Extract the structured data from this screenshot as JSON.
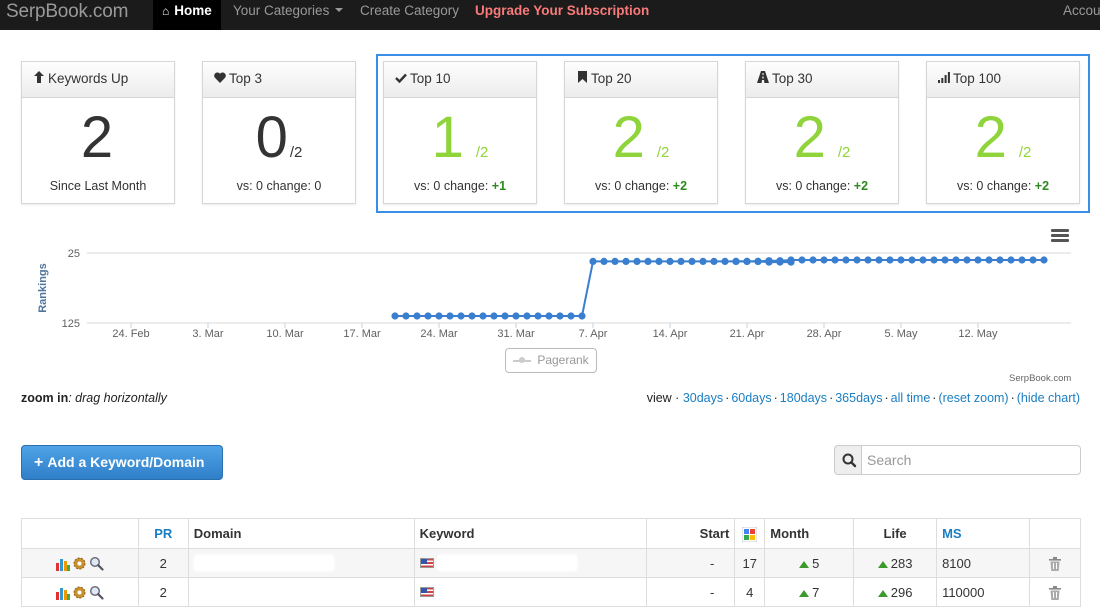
{
  "navbar": {
    "brand": "SerpBook.com",
    "home": "Home",
    "categories": "Your Categories",
    "create": "Create Category",
    "upgrade": "Upgrade Your Subscription",
    "account": "Accou"
  },
  "stats": [
    {
      "title": "Keywords Up",
      "icon": "arrow-up-icon",
      "value": "2",
      "denom": "",
      "footer_text": "Since Last Month",
      "change": ""
    },
    {
      "title": "Top 3",
      "icon": "heart-icon",
      "value": "0",
      "denom": "/2",
      "footer_text": "vs: 0 change: 0",
      "change": ""
    },
    {
      "title": "Top 10",
      "icon": "check-icon",
      "value": "1",
      "denom": "/2",
      "footer_text": "vs: 0 change: ",
      "change": "+1"
    },
    {
      "title": "Top 20",
      "icon": "bookmark-icon",
      "value": "2",
      "denom": "/2",
      "footer_text": "vs: 0 change: ",
      "change": "+2"
    },
    {
      "title": "Top 30",
      "icon": "road-icon",
      "value": "2",
      "denom": "/2",
      "footer_text": "vs: 0 change: ",
      "change": "+2"
    },
    {
      "title": "Top 100",
      "icon": "signal-icon",
      "value": "2",
      "denom": "/2",
      "footer_text": "vs: 0 change: ",
      "change": "+2"
    }
  ],
  "colors": {
    "accent_green": "#8fd43a",
    "link_blue": "#1a7ec2",
    "series_blue": "#3a7fcf",
    "highlight": "#3a8ee6"
  },
  "chart_data": {
    "type": "line",
    "ylabel": "Rankings",
    "yticks": [
      "25",
      "125"
    ],
    "ylim": [
      125,
      25
    ],
    "reversed_y": true,
    "xticks": [
      "24. Feb",
      "3. Mar",
      "10. Mar",
      "17. Mar",
      "24. Mar",
      "31. Mar",
      "7. Apr",
      "14. Apr",
      "21. Apr",
      "28. Apr",
      "5. May",
      "12. May"
    ],
    "grid": true,
    "legend": [
      "Pagerank"
    ],
    "series": [
      {
        "segment": 1,
        "start": "2013-03-20",
        "values": [
          115,
          115,
          115,
          115,
          115,
          115,
          115,
          115,
          115,
          115,
          115,
          115,
          115,
          115,
          115,
          115,
          115,
          115,
          37,
          37,
          37,
          37,
          37,
          37,
          37,
          37,
          37,
          37,
          37,
          37,
          37,
          37,
          37,
          37,
          38,
          38,
          38
        ]
      },
      {
        "segment": 2,
        "start": "2013-04-20",
        "values": [
          37,
          37,
          37,
          36,
          36,
          35,
          35,
          35,
          35,
          35,
          35,
          35,
          35,
          35,
          35,
          35,
          35,
          35,
          35,
          35,
          35,
          35,
          35,
          35,
          35,
          35,
          35,
          35,
          35
        ]
      }
    ]
  },
  "credit": "SerpBook.com",
  "zoom_hint": {
    "label": "zoom in",
    "text": ": drag horizontally"
  },
  "view": {
    "label": "view · ",
    "links": [
      "30days",
      "60days",
      "180days",
      "365days",
      "all time",
      "(reset zoom)",
      "(hide chart)"
    ]
  },
  "add_button": "Add a Keyword/Domain",
  "search": {
    "placeholder": "Search"
  },
  "table": {
    "headers": {
      "pr": "PR",
      "domain": "Domain",
      "keyword": "Keyword",
      "start": "Start",
      "month": "Month",
      "life": "Life",
      "ms": "MS"
    },
    "rows": [
      {
        "pr": "2",
        "start": "-",
        "google": "17",
        "month": "5",
        "life": "283",
        "ms": "8100"
      },
      {
        "pr": "2",
        "start": "-",
        "google": "4",
        "month": "7",
        "life": "296",
        "ms": "110000"
      }
    ]
  }
}
